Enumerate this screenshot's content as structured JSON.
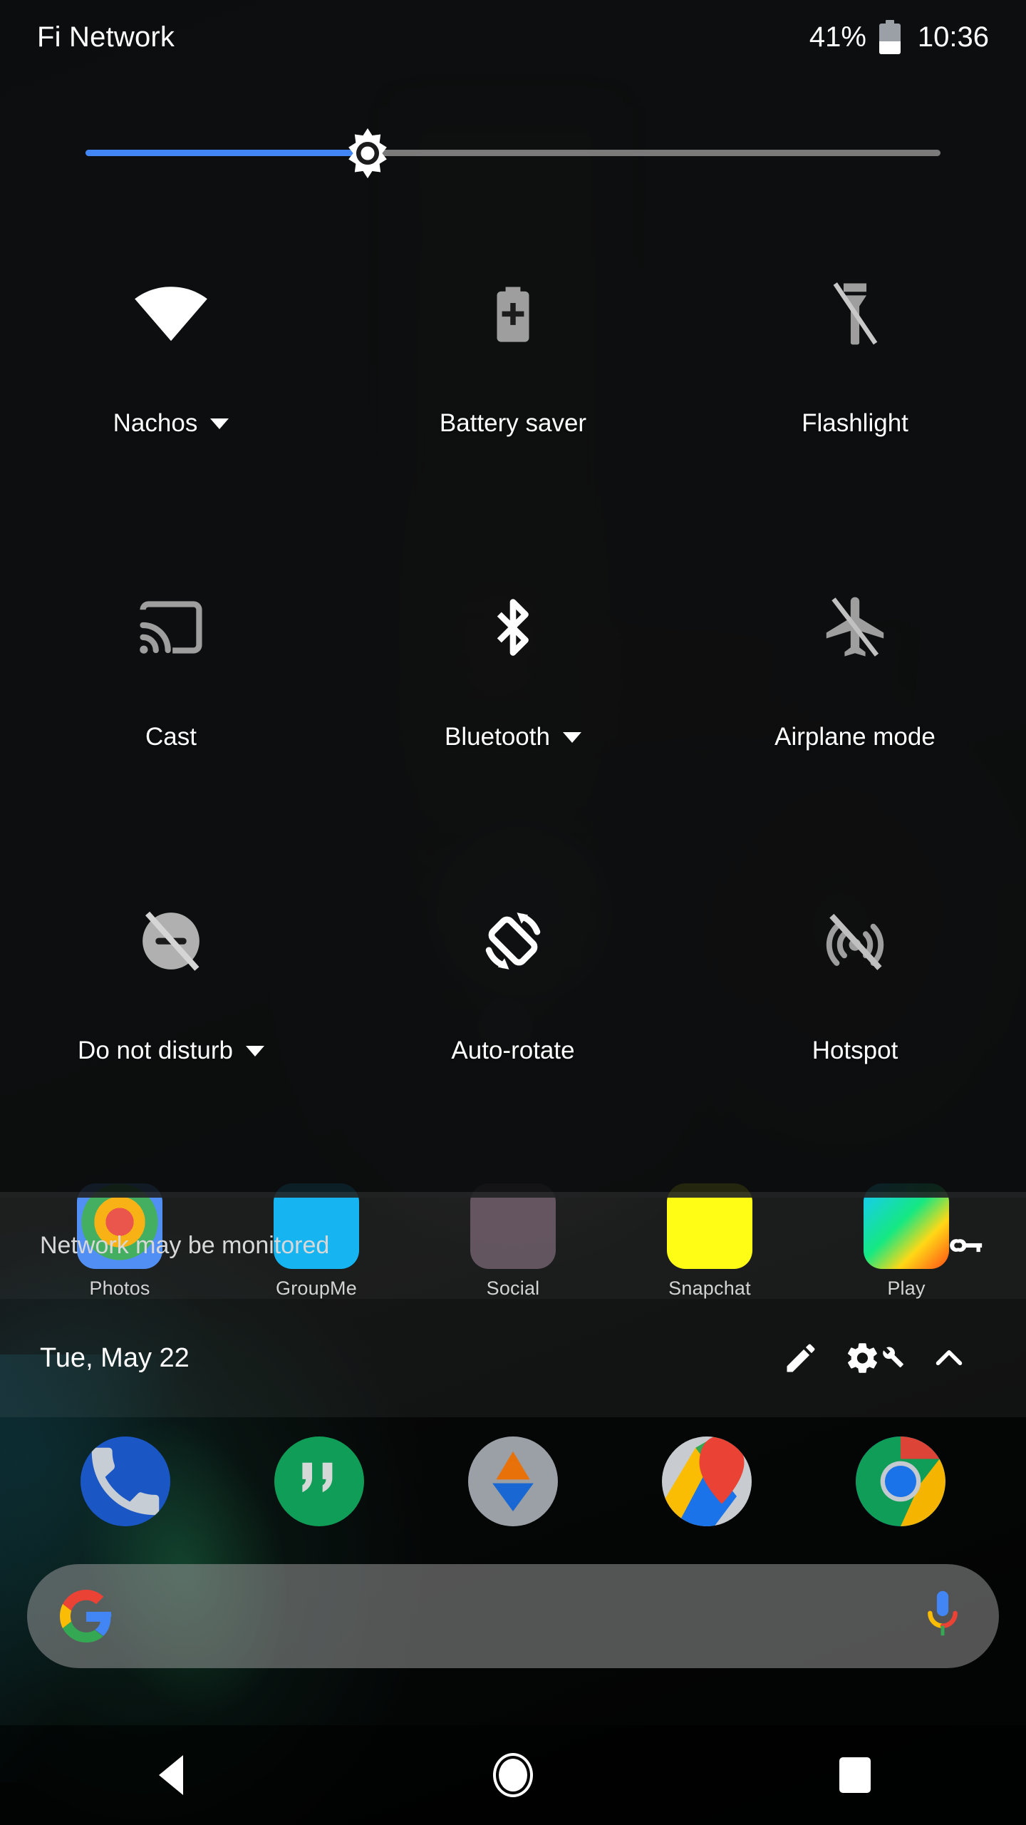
{
  "status_bar": {
    "carrier": "Fi Network",
    "battery_percent": "41%",
    "battery_level": 41,
    "clock": "10:36",
    "battery_icon": "battery-icon"
  },
  "brightness": {
    "name": "brightness-slider",
    "value_percent": 33,
    "fill_color": "#4285f4",
    "track_color": "#7a7a7a",
    "thumb_icon": "brightness-sun-icon"
  },
  "tiles": [
    {
      "label": "Nachos",
      "icon": "wifi-icon",
      "state": "on",
      "color": "#ffffff",
      "has_chevron": true,
      "name": "tile-wifi"
    },
    {
      "label": "Battery saver",
      "icon": "battery-saver-icon",
      "state": "off",
      "color": "#9e9e9e",
      "has_chevron": false,
      "name": "tile-battery-saver"
    },
    {
      "label": "Flashlight",
      "icon": "flashlight-off-icon",
      "state": "off",
      "color": "#9e9e9e",
      "has_chevron": false,
      "name": "tile-flashlight"
    },
    {
      "label": "Cast",
      "icon": "cast-icon",
      "state": "off",
      "color": "#9e9e9e",
      "has_chevron": false,
      "name": "tile-cast"
    },
    {
      "label": "Bluetooth",
      "icon": "bluetooth-icon",
      "state": "on",
      "color": "#ffffff",
      "has_chevron": true,
      "name": "tile-bluetooth"
    },
    {
      "label": "Airplane mode",
      "icon": "airplane-off-icon",
      "state": "off",
      "color": "#9e9e9e",
      "has_chevron": false,
      "name": "tile-airplane-mode"
    },
    {
      "label": "Do not disturb",
      "icon": "do-not-disturb-off-icon",
      "state": "off",
      "color": "#b0b0b0",
      "has_chevron": true,
      "name": "tile-do-not-disturb"
    },
    {
      "label": "Auto-rotate",
      "icon": "auto-rotate-icon",
      "state": "on",
      "color": "#ffffff",
      "has_chevron": false,
      "name": "tile-auto-rotate"
    },
    {
      "label": "Hotspot",
      "icon": "hotspot-off-icon",
      "state": "off",
      "color": "#9e9e9e",
      "has_chevron": false,
      "name": "tile-hotspot"
    }
  ],
  "monitor_banner": {
    "text": "Network may be monitored",
    "icon": "key-icon"
  },
  "footer": {
    "date": "Tue, May 22",
    "edit_icon": "pencil-edit-icon",
    "settings_icon": "settings-gear-icon",
    "tuner_icon": "wrench-icon",
    "collapse_icon": "chevron-up-icon"
  },
  "home_screen": {
    "app_row": [
      {
        "label": "Photos",
        "name": "app-photos"
      },
      {
        "label": "GroupMe",
        "name": "app-groupme"
      },
      {
        "label": "Social",
        "name": "app-social"
      },
      {
        "label": "Snapchat",
        "name": "app-snapchat"
      },
      {
        "label": "Play",
        "name": "app-play"
      }
    ],
    "dock": [
      {
        "name": "dock-phone",
        "icon": "phone-icon"
      },
      {
        "name": "dock-hangouts",
        "icon": "hangouts-icon"
      },
      {
        "name": "dock-drive",
        "icon": "drive-icon"
      },
      {
        "name": "dock-maps",
        "icon": "maps-icon"
      },
      {
        "name": "dock-chrome",
        "icon": "chrome-icon"
      }
    ],
    "search": {
      "placeholder": "",
      "value": "",
      "google_icon": "google-g-icon",
      "mic_icon": "microphone-icon"
    }
  },
  "nav_bar": {
    "back": "back-icon",
    "home": "home-icon",
    "recents": "recents-icon"
  }
}
